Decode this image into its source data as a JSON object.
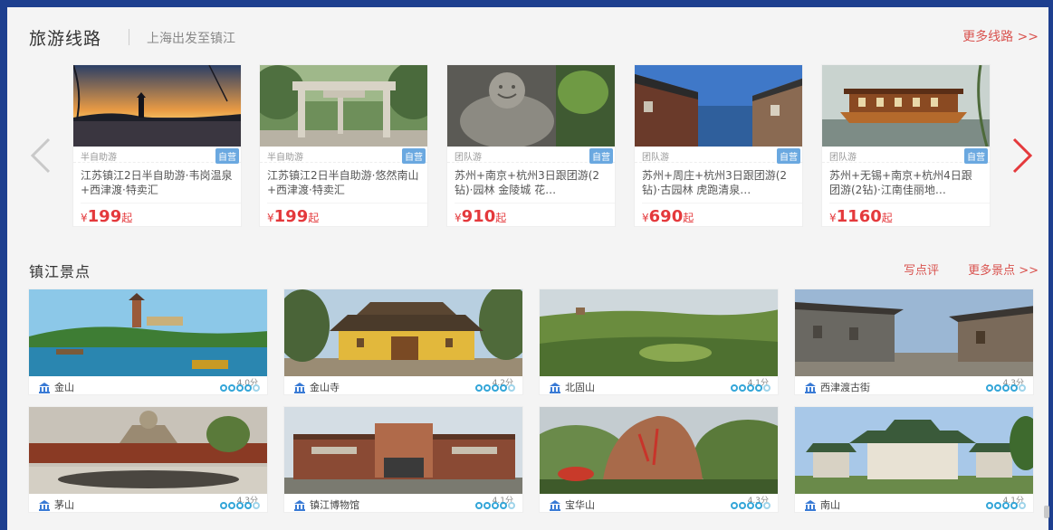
{
  "routes": {
    "title": "旅游线路",
    "subtitle": "上海出发至镇江",
    "more": "更多线路 >>",
    "currency": "¥",
    "price_suffix": "起",
    "items": [
      {
        "type": "半自助游",
        "badge": "自营",
        "title": "江苏镇江2日半自助游·韦岗温泉+西津渡·特卖汇",
        "price": "199"
      },
      {
        "type": "半自助游",
        "badge": "自营",
        "title": "江苏镇江2日半自助游·悠然南山+西津渡·特卖汇",
        "price": "199"
      },
      {
        "type": "团队游",
        "badge": "自营",
        "title": "苏州+南京+杭州3日跟团游(2钻)·园林 金陵城 花…",
        "price": "910"
      },
      {
        "type": "团队游",
        "badge": "自营",
        "title": "苏州+周庄+杭州3日跟团游(2钻)·古园林 虎跑清泉…",
        "price": "690"
      },
      {
        "type": "团队游",
        "badge": "自营",
        "title": "苏州+无锡+南京+杭州4日跟团游(2钻)·江南佳丽地…",
        "price": "1160"
      }
    ]
  },
  "spots": {
    "title": "镇江景点",
    "review": "写点评",
    "more": "更多景点 >>",
    "items": [
      {
        "name": "金山",
        "score": "4.0分",
        "rating": 4
      },
      {
        "name": "金山寺",
        "score": "4.2分",
        "rating": 4
      },
      {
        "name": "北固山",
        "score": "4.1分",
        "rating": 4
      },
      {
        "name": "西津渡古街",
        "score": "4.3分",
        "rating": 4
      },
      {
        "name": "茅山",
        "score": "4.3分",
        "rating": 4
      },
      {
        "name": "镇江博物馆",
        "score": "4.1分",
        "rating": 4
      },
      {
        "name": "宝华山",
        "score": "4.3分",
        "rating": 4
      },
      {
        "name": "南山",
        "score": "4.1分",
        "rating": 4
      }
    ]
  },
  "colors": {
    "page_frame": "#1e3f8f",
    "accent_red": "#e4393c",
    "badge_blue": "#6aa8e0",
    "rating_blue": "#34a6d8"
  },
  "icons": [
    "chevron-left-icon",
    "chevron-right-icon",
    "landmark-icon",
    "rating-circle-icon"
  ]
}
